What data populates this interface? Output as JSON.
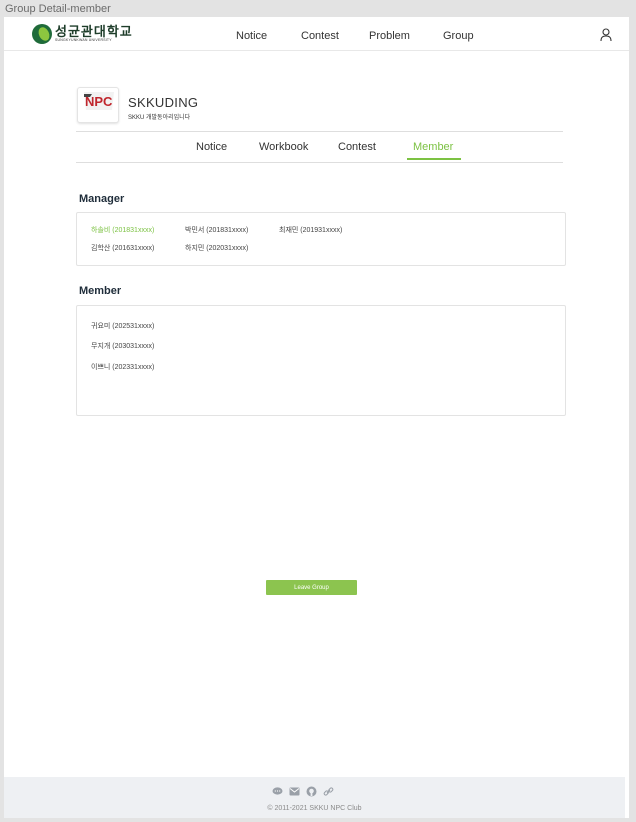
{
  "frame_label": "Group Detail-member",
  "header": {
    "logo_ko": "성균관대학교",
    "logo_en": "SUNGKYUNKWAN UNIVERSITY",
    "nav": [
      "Notice",
      "Contest",
      "Problem",
      "Group"
    ],
    "user_icon": "user-icon"
  },
  "group": {
    "logo_text": "NPC",
    "name": "SKKUDING",
    "description": "SKKU 개발동아리입니다"
  },
  "tabs": {
    "items": [
      "Notice",
      "Workbook",
      "Contest",
      "Member"
    ],
    "active": "Member"
  },
  "manager": {
    "title": "Manager",
    "rows": [
      [
        "하솔비 (201831xxxx)",
        "박민서 (201831xxxx)",
        "최재민 (201931xxxx)"
      ],
      [
        "김학산 (201631xxxx)",
        "하지민 (202031xxxx)"
      ]
    ],
    "highlighted": "하솔비 (201831xxxx)"
  },
  "member": {
    "title": "Member",
    "items": [
      "귀요미 (202531xxxx)",
      "무지개 (203031xxxx)",
      "이쁘니 (202331xxxx)"
    ]
  },
  "actions": {
    "leave_label": "Leave Group"
  },
  "footer": {
    "icons": [
      "chat-icon",
      "mail-icon",
      "github-icon",
      "link-icon"
    ],
    "copyright": "© 2011-2021 SKKU NPC Club"
  },
  "colors": {
    "accent": "#7cc243",
    "button": "#8cc44f",
    "footer_bg": "#eef0f3"
  }
}
